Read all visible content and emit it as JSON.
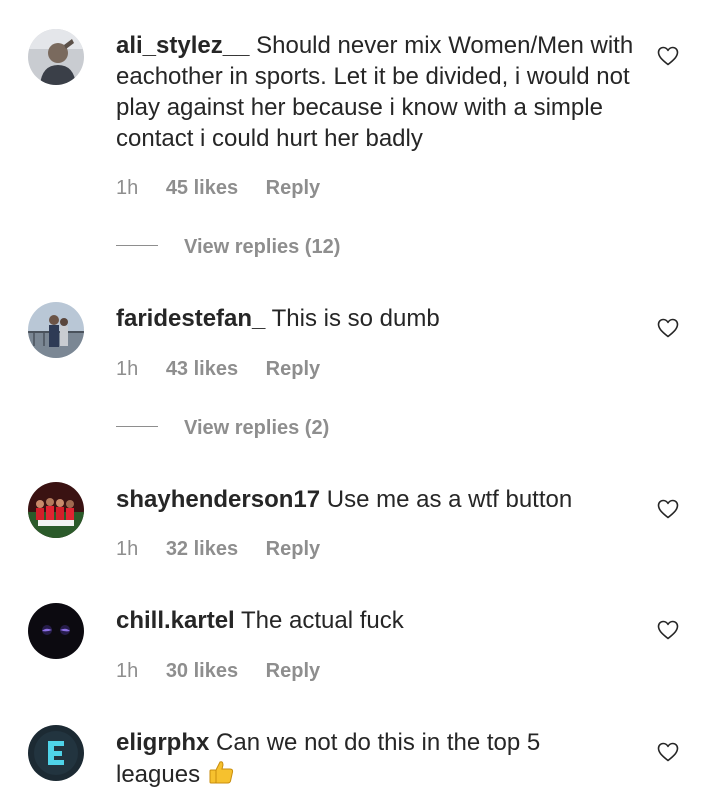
{
  "comments": [
    {
      "username": "ali_stylez__",
      "text": "Should never mix Women/Men with eachother in sports. Let it be divided, i would not play against her because i know with a simple contact i could hurt her badly",
      "time": "1h",
      "likes": "45 likes",
      "reply": "Reply",
      "view_replies": "View replies (12)"
    },
    {
      "username": "faridestefan_",
      "text": "This is so dumb",
      "time": "1h",
      "likes": "43 likes",
      "reply": "Reply",
      "view_replies": "View replies (2)"
    },
    {
      "username": "shayhenderson17",
      "text": "Use me as a wtf button",
      "time": "1h",
      "likes": "32 likes",
      "reply": "Reply"
    },
    {
      "username": "chill.kartel",
      "text": "The actual fuck",
      "time": "1h",
      "likes": "30 likes",
      "reply": "Reply"
    },
    {
      "username": "eligrphx",
      "text": "Can we not do this in the top 5 leagues",
      "emoji": "thumbs-up-emoji"
    }
  ],
  "icons": {
    "like": "heart-outline-icon"
  },
  "colors": {
    "text": "#262626",
    "muted": "#8e8e8e",
    "background": "#ffffff"
  }
}
